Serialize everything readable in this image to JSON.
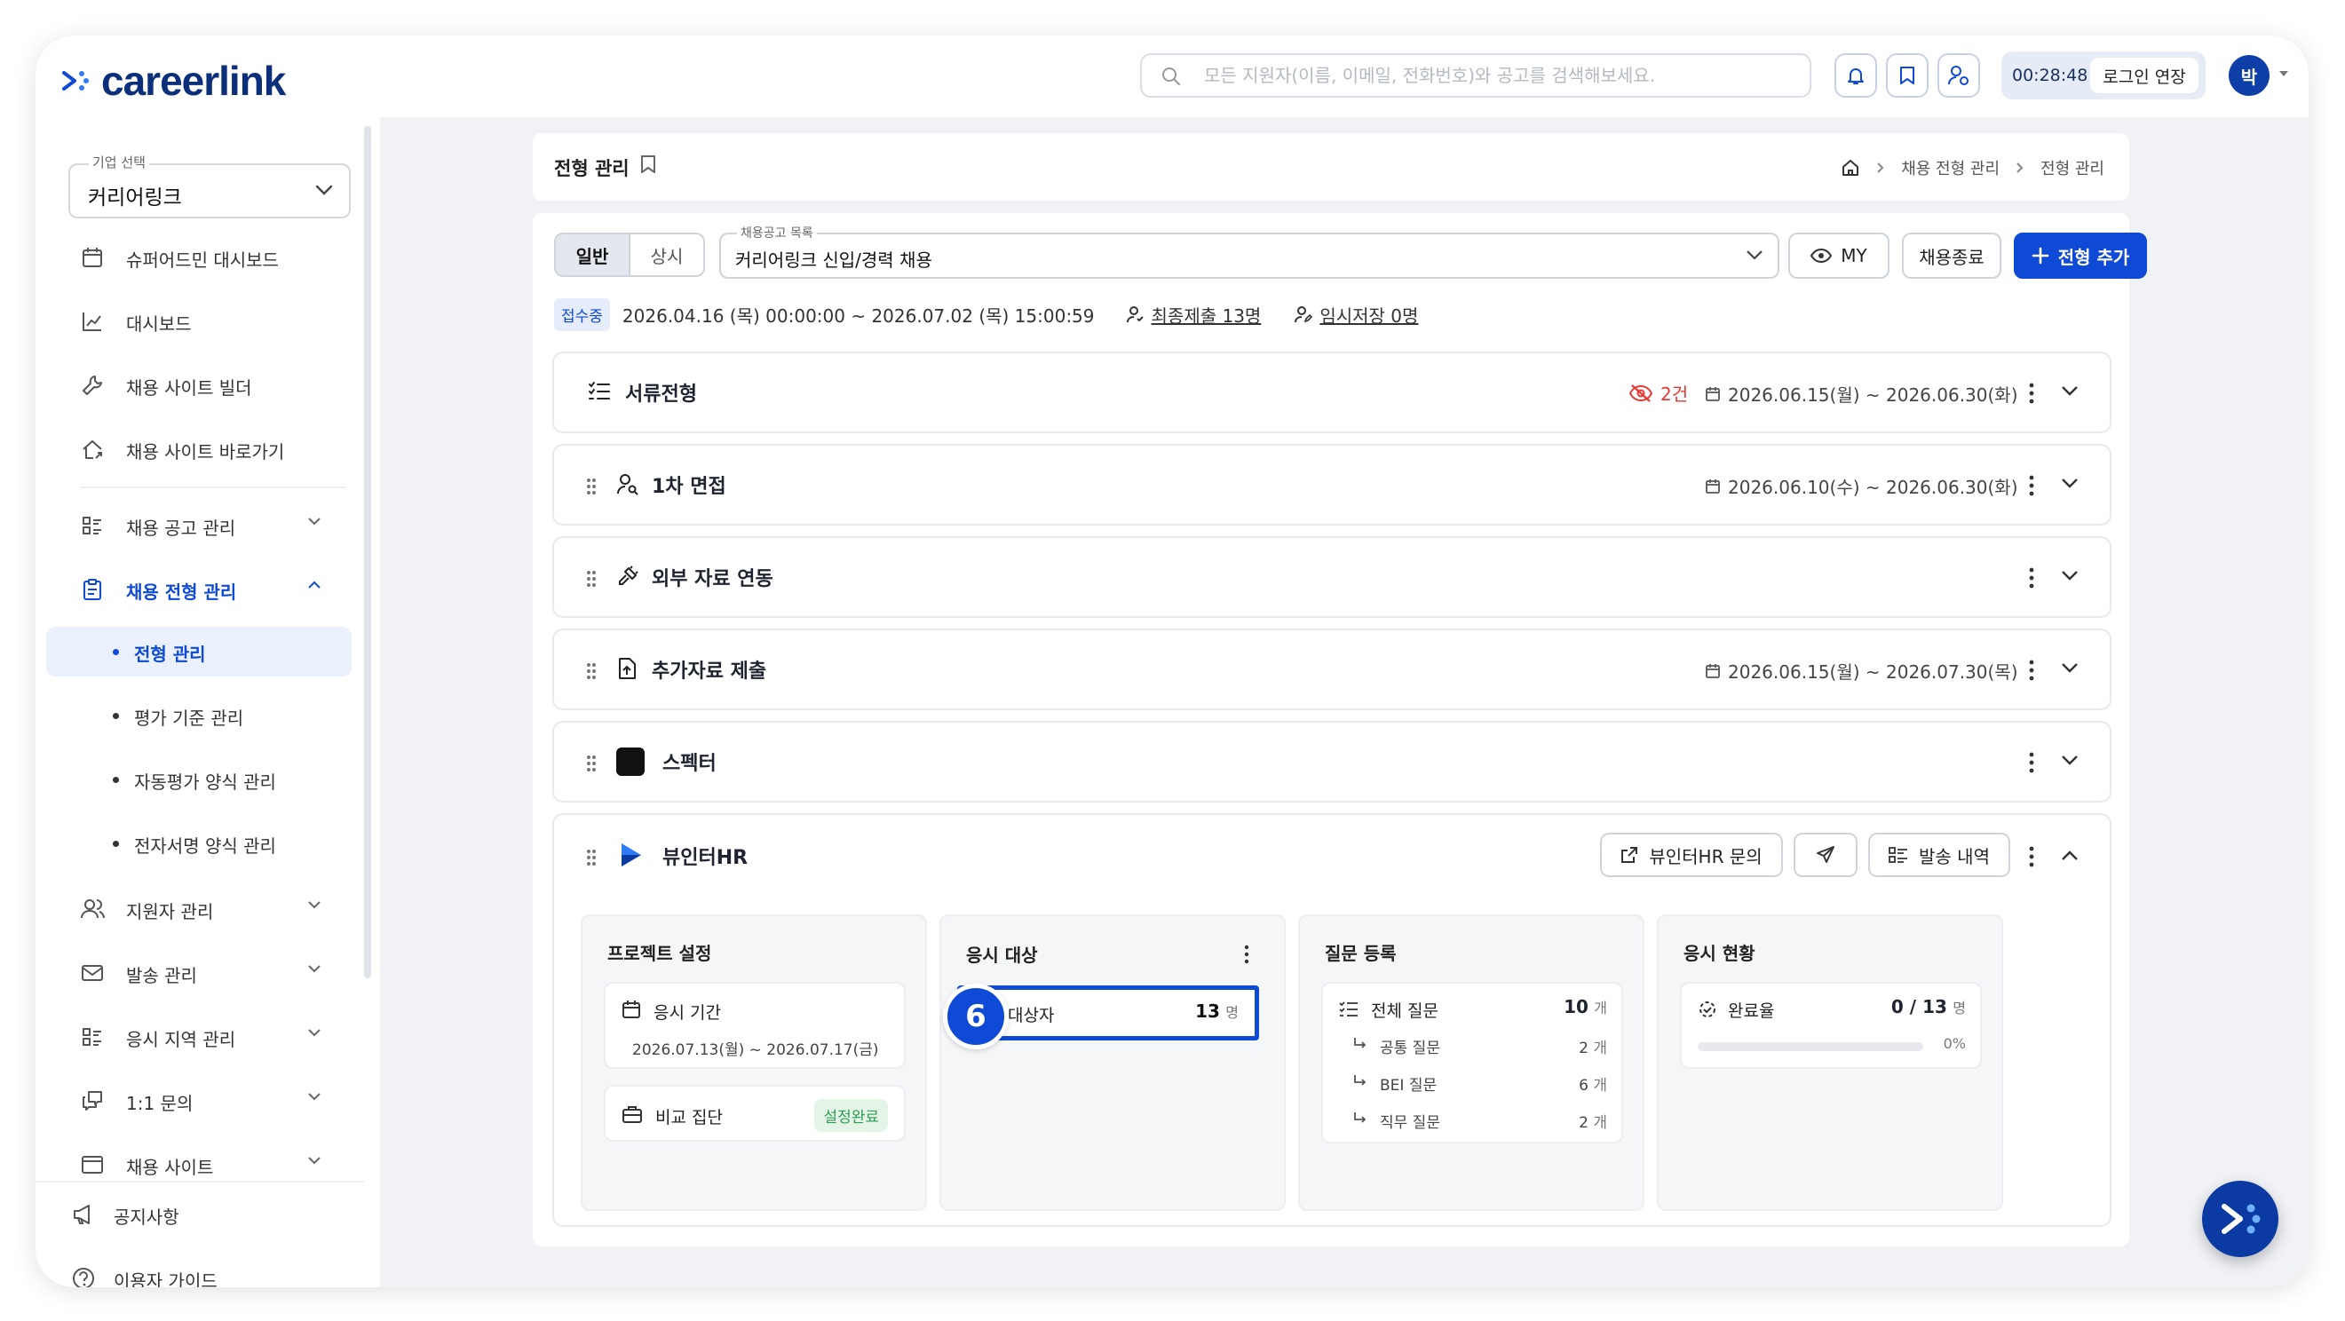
{
  "brand": {
    "name": "careerlink"
  },
  "topbar": {
    "search_placeholder": "모든 지원자(이름, 이메일, 전화번호)와 공고를 검색해보세요.",
    "timer": "00:28:48",
    "extend_label": "로그인 연장",
    "avatar_initial": "박"
  },
  "sidebar": {
    "company_label": "기업 선택",
    "company_value": "커리어링크",
    "items": [
      {
        "label": "슈퍼어드민 대시보드",
        "icon": "calendar-icon"
      },
      {
        "label": "대시보드",
        "icon": "chart-icon"
      },
      {
        "label": "채용 사이트 빌더",
        "icon": "wrench-icon"
      },
      {
        "label": "채용 사이트 바로가기",
        "icon": "home-link-icon"
      },
      {
        "label": "채용 공고 관리",
        "icon": "list-icon"
      },
      {
        "label": "채용 전형 관리",
        "icon": "clipboard-icon"
      },
      {
        "label": "지원자 관리",
        "icon": "users-icon"
      },
      {
        "label": "발송 관리",
        "icon": "mail-icon"
      },
      {
        "label": "응시 지역 관리",
        "icon": "list-icon"
      },
      {
        "label": "1:1 문의",
        "icon": "chat-icon"
      },
      {
        "label": "채용 사이트",
        "icon": "window-icon"
      }
    ],
    "subitems": [
      "전형 관리",
      "평가 기준 관리",
      "자동평가 양식 관리",
      "전자서명 양식 관리"
    ],
    "footer": [
      {
        "label": "공지사항",
        "icon": "megaphone-icon"
      },
      {
        "label": "이용자 가이드",
        "icon": "help-icon"
      }
    ]
  },
  "header": {
    "title": "전형 관리",
    "breadcrumb": [
      "채용 전형 관리",
      "전형 관리"
    ]
  },
  "toolbar": {
    "tabs": [
      "일반",
      "상시"
    ],
    "job_label": "채용공고 목록",
    "job_value": "커리어링크 신입/경력 채용",
    "my_label": "MY",
    "close_label": "채용종료",
    "add_label": "전형 추가"
  },
  "status": {
    "badge": "접수중",
    "period": "2026.04.16 (목) 00:00:00 ~ 2026.07.02 (목) 15:00:59",
    "final_submit": "최종제출 13명",
    "temp_save": "임시저장 0명"
  },
  "steps": [
    {
      "name": "서류전형",
      "date": "2026.06.15(월) ~ 2026.06.30(화)",
      "hidden_count": "2건"
    },
    {
      "name": "1차 면접",
      "date": "2026.06.10(수) ~ 2026.06.30(화)"
    },
    {
      "name": "외부 자료 연동",
      "date": ""
    },
    {
      "name": "추가자료 제출",
      "date": "2026.06.15(월) ~ 2026.07.30(목)"
    },
    {
      "name": "스펙터",
      "date": ""
    },
    {
      "name": "뷰인터HR",
      "date": ""
    }
  ],
  "viewinter": {
    "inquiry_label": "뷰인터HR 문의",
    "history_label": "발송 내역",
    "project": {
      "title": "프로젝트 설정",
      "period_label": "응시 기간",
      "period_value": "2026.07.13(월) ~ 2026.07.17(금)",
      "group_label": "비교 집단",
      "group_status": "설정완료"
    },
    "targets": {
      "title": "응시 대상",
      "row_label": "대상자",
      "row_count": "13",
      "row_unit": "명"
    },
    "questions": {
      "title": "질문 등록",
      "total_label": "전체 질문",
      "total_count": "10",
      "unit": "개",
      "rows": [
        {
          "label": "공통 질문",
          "count": "2"
        },
        {
          "label": "BEI 질문",
          "count": "6"
        },
        {
          "label": "직무 질문",
          "count": "2"
        }
      ]
    },
    "status": {
      "title": "응시 현황",
      "rate_label": "완료율",
      "rate_value": "0 / 13",
      "unit": "명",
      "percent_label": "0%",
      "progress": 0
    }
  },
  "annotation_number": "6",
  "colors": {
    "primary": "#0f4ad6",
    "danger": "#e53935",
    "success": "#2e9d52"
  }
}
